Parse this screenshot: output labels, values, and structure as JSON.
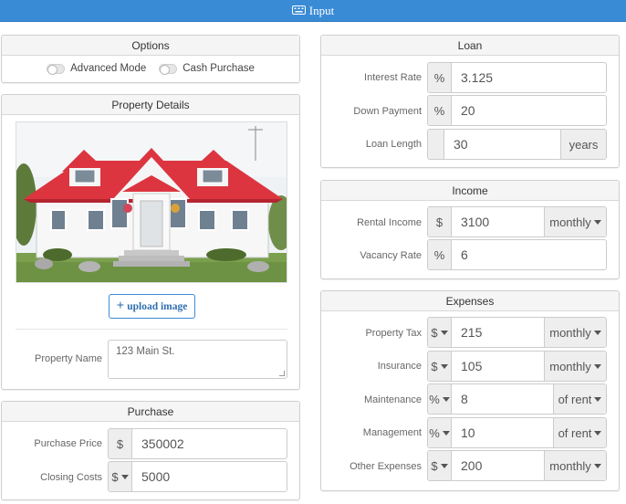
{
  "topbar": {
    "icon": "keyboard-icon",
    "title": "Input"
  },
  "options": {
    "title": "Options",
    "advanced_mode": "Advanced Mode",
    "cash_purchase": "Cash Purchase"
  },
  "property": {
    "title": "Property Details",
    "upload_label": "upload image",
    "name_label": "Property Name",
    "name_placeholder": "123 Main St."
  },
  "purchase": {
    "title": "Purchase",
    "price_label": "Purchase Price",
    "price_addon": "$",
    "price_value": "350002",
    "closing_label": "Closing Costs",
    "closing_addon": "$",
    "closing_value": "5000"
  },
  "loan": {
    "title": "Loan",
    "rate_label": "Interest Rate",
    "rate_addon": "%",
    "rate_value": "3.125",
    "down_label": "Down Payment",
    "down_addon": "%",
    "down_value": "20",
    "length_label": "Loan Length",
    "length_value": "30",
    "length_unit": "years"
  },
  "income": {
    "title": "Income",
    "rental_label": "Rental Income",
    "rental_addon": "$",
    "rental_value": "3100",
    "rental_period": "monthly",
    "vacancy_label": "Vacancy Rate",
    "vacancy_addon": "%",
    "vacancy_value": "6"
  },
  "expenses": {
    "title": "Expenses",
    "tax_label": "Property Tax",
    "tax_addon": "$",
    "tax_value": "215",
    "tax_period": "monthly",
    "ins_label": "Insurance",
    "ins_addon": "$",
    "ins_value": "105",
    "ins_period": "monthly",
    "maint_label": "Maintenance",
    "maint_addon": "%",
    "maint_value": "8",
    "maint_period": "of rent",
    "mgmt_label": "Management",
    "mgmt_addon": "%",
    "mgmt_value": "10",
    "mgmt_period": "of rent",
    "other_label": "Other Expenses",
    "other_addon": "$",
    "other_value": "200",
    "other_period": "monthly"
  }
}
